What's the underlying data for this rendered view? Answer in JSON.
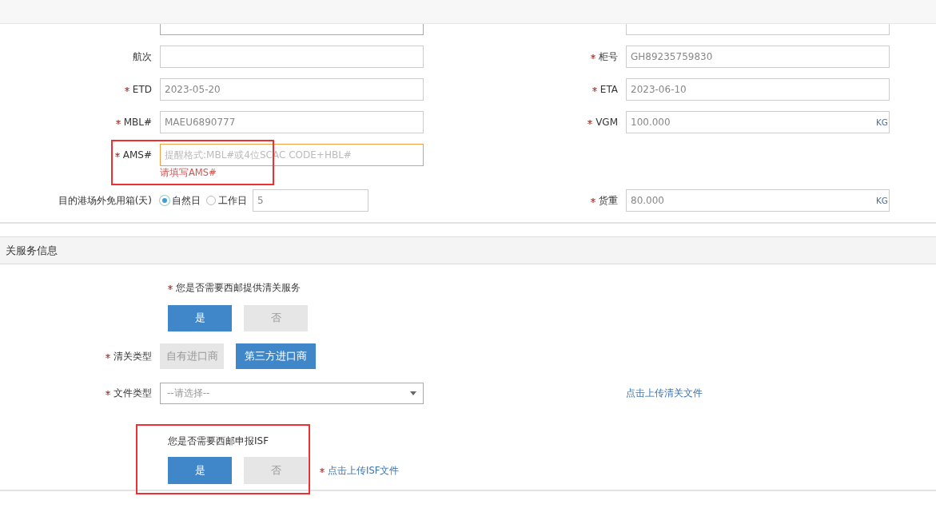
{
  "shipping_form": {
    "rows": [
      {
        "left": {
          "kind": "cut-select"
        },
        "right": {
          "kind": "cut-input"
        }
      },
      {
        "left": {
          "label": "航次",
          "required": false,
          "kind": "input"
        },
        "right": {
          "label": "柜号",
          "required": true,
          "kind": "input",
          "value": "GH89235759830"
        }
      },
      {
        "left": {
          "label": "ETD",
          "required": true,
          "kind": "input",
          "value": "2023-05-20"
        },
        "right": {
          "label": "ETA",
          "required": true,
          "kind": "input",
          "value": "2023-06-10"
        }
      },
      {
        "left": {
          "label": "MBL#",
          "required": true,
          "kind": "input",
          "value": "MAEU6890777"
        },
        "right": {
          "label": "VGM",
          "required": true,
          "kind": "unit",
          "value": "100.000",
          "unit": "KG"
        }
      },
      {
        "left": {
          "label": "AMS#",
          "required": true,
          "kind": "input",
          "placeholder": "提醒格式:MBL#或4位SCAC CODE+HBL#",
          "error": "请填写AMS#",
          "focused": true,
          "highlighted": true
        }
      },
      {
        "left": {
          "label": "目的港场外免用箱(天)",
          "required": false,
          "kind": "days",
          "options": [
            {
              "label": "自然日",
              "selected": true
            },
            {
              "label": "工作日",
              "selected": false
            }
          ],
          "value": "5"
        },
        "right": {
          "label": "货重",
          "required": true,
          "kind": "unit",
          "value": "80.000",
          "unit": "KG"
        }
      }
    ]
  },
  "clearance_section": {
    "title": "关服务信息",
    "service_question": {
      "text": "您是否需要西邮提供清关服务",
      "required": true
    },
    "service_choices": [
      {
        "label": "是",
        "selected": true
      },
      {
        "label": "否",
        "selected": false
      }
    ],
    "clearance_type": {
      "label": "清关类型",
      "required": true,
      "options": [
        {
          "label": "自有进口商",
          "selected": false
        },
        {
          "label": "第三方进口商",
          "selected": true
        }
      ]
    },
    "file_type": {
      "label": "文件类型",
      "required": true,
      "placeholder": "--请选择--"
    },
    "upload_link": "点击上传清关文件",
    "isf_block": {
      "question": "您是否需要西邮申报ISF",
      "highlighted": true,
      "choices": [
        {
          "label": "是",
          "selected": true
        },
        {
          "label": "否",
          "selected": false
        }
      ],
      "upload": {
        "text": "点击上传ISF文件",
        "required": true
      }
    }
  }
}
